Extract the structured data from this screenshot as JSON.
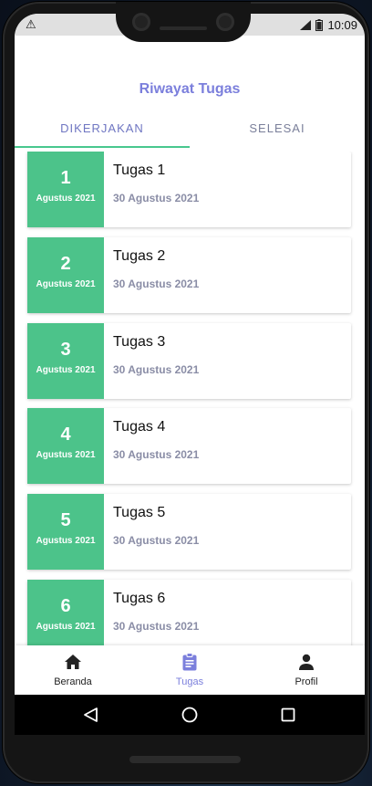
{
  "status_bar": {
    "alert_icon": "warning-triangle",
    "time": "10:09"
  },
  "page": {
    "title": "Riwayat Tugas"
  },
  "tabs": [
    {
      "label": "DIKERJAKAN",
      "active": true
    },
    {
      "label": "SELESAI",
      "active": false
    }
  ],
  "tasks": [
    {
      "day": "1",
      "month": "Agustus 2021",
      "name": "Tugas 1",
      "due": "30 Agustus 2021"
    },
    {
      "day": "2",
      "month": "Agustus 2021",
      "name": "Tugas 2",
      "due": "30 Agustus 2021"
    },
    {
      "day": "3",
      "month": "Agustus 2021",
      "name": "Tugas 3",
      "due": "30 Agustus 2021"
    },
    {
      "day": "4",
      "month": "Agustus 2021",
      "name": "Tugas 4",
      "due": "30 Agustus 2021"
    },
    {
      "day": "5",
      "month": "Agustus 2021",
      "name": "Tugas 5",
      "due": "30 Agustus 2021"
    },
    {
      "day": "6",
      "month": "Agustus 2021",
      "name": "Tugas 6",
      "due": "30 Agustus 2021"
    }
  ],
  "bottom_nav": [
    {
      "label": "Beranda",
      "icon": "home-icon",
      "active": false
    },
    {
      "label": "Tugas",
      "icon": "clipboard-icon",
      "active": true
    },
    {
      "label": "Profil",
      "icon": "person-icon",
      "active": false
    }
  ],
  "colors": {
    "accent": "#7b7fdc",
    "date_box": "#4cc38a",
    "tab_indicator": "#48c78e",
    "muted_text": "#8a8da6"
  }
}
